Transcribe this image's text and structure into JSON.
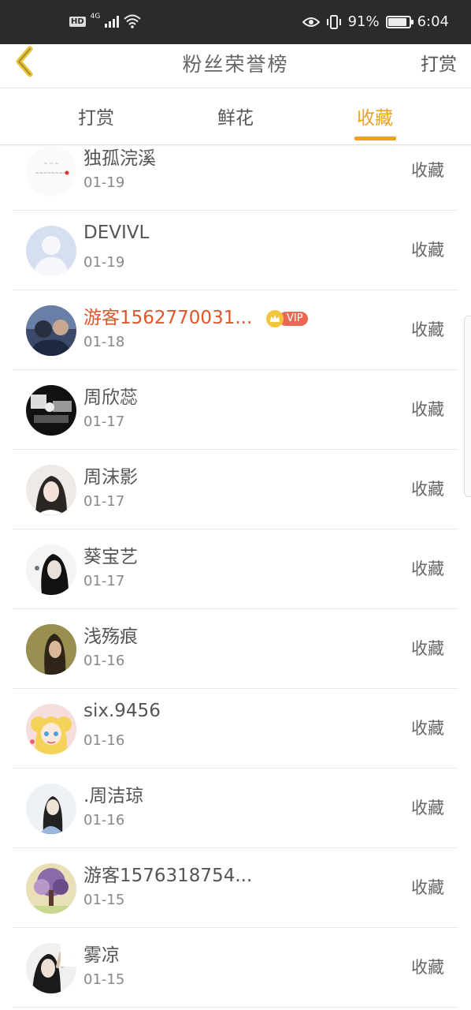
{
  "status_bar": {
    "hd": "HD",
    "network": "4G",
    "battery_percent": "91%",
    "battery_level": 0.91,
    "time": "6:04"
  },
  "header": {
    "title": "粉丝荣誉榜",
    "action": "打赏",
    "back_icon": "chevron-left-icon"
  },
  "tabs": [
    {
      "label": "打赏",
      "active": false
    },
    {
      "label": "鲜花",
      "active": false
    },
    {
      "label": "收藏",
      "active": true
    }
  ],
  "colors": {
    "accent": "#f0a020",
    "vip_name": "#e2552a",
    "vip_badge": "#e86a55"
  },
  "vip_badge_label": "VIP",
  "fans": [
    {
      "name": "独孤浣溪",
      "date": "01-19",
      "action": "收藏",
      "avatar": "text-note-avatar"
    },
    {
      "name": "DEVIVL",
      "date": "01-19",
      "action": "收藏",
      "avatar": "default-user-avatar"
    },
    {
      "name": "游客1562770031...",
      "date": "01-18",
      "action": "收藏",
      "avatar": "photo-avatar",
      "vip": true
    },
    {
      "name": "周欣蕊",
      "date": "01-17",
      "action": "收藏",
      "avatar": "photo-avatar"
    },
    {
      "name": "周沫影",
      "date": "01-17",
      "action": "收藏",
      "avatar": "photo-avatar"
    },
    {
      "name": "葵宝艺",
      "date": "01-17",
      "action": "收藏",
      "avatar": "photo-avatar"
    },
    {
      "name": "浅殇痕",
      "date": "01-16",
      "action": "收藏",
      "avatar": "photo-avatar"
    },
    {
      "name": "six.9456",
      "date": "01-16",
      "action": "收藏",
      "avatar": "cartoon-avatar"
    },
    {
      "name": ".周洁琼",
      "date": "01-16",
      "action": "收藏",
      "avatar": "photo-avatar"
    },
    {
      "name": "游客1576318754...",
      "date": "01-15",
      "action": "收藏",
      "avatar": "photo-avatar"
    },
    {
      "name": "雾凉",
      "date": "01-15",
      "action": "收藏",
      "avatar": "photo-avatar"
    }
  ]
}
